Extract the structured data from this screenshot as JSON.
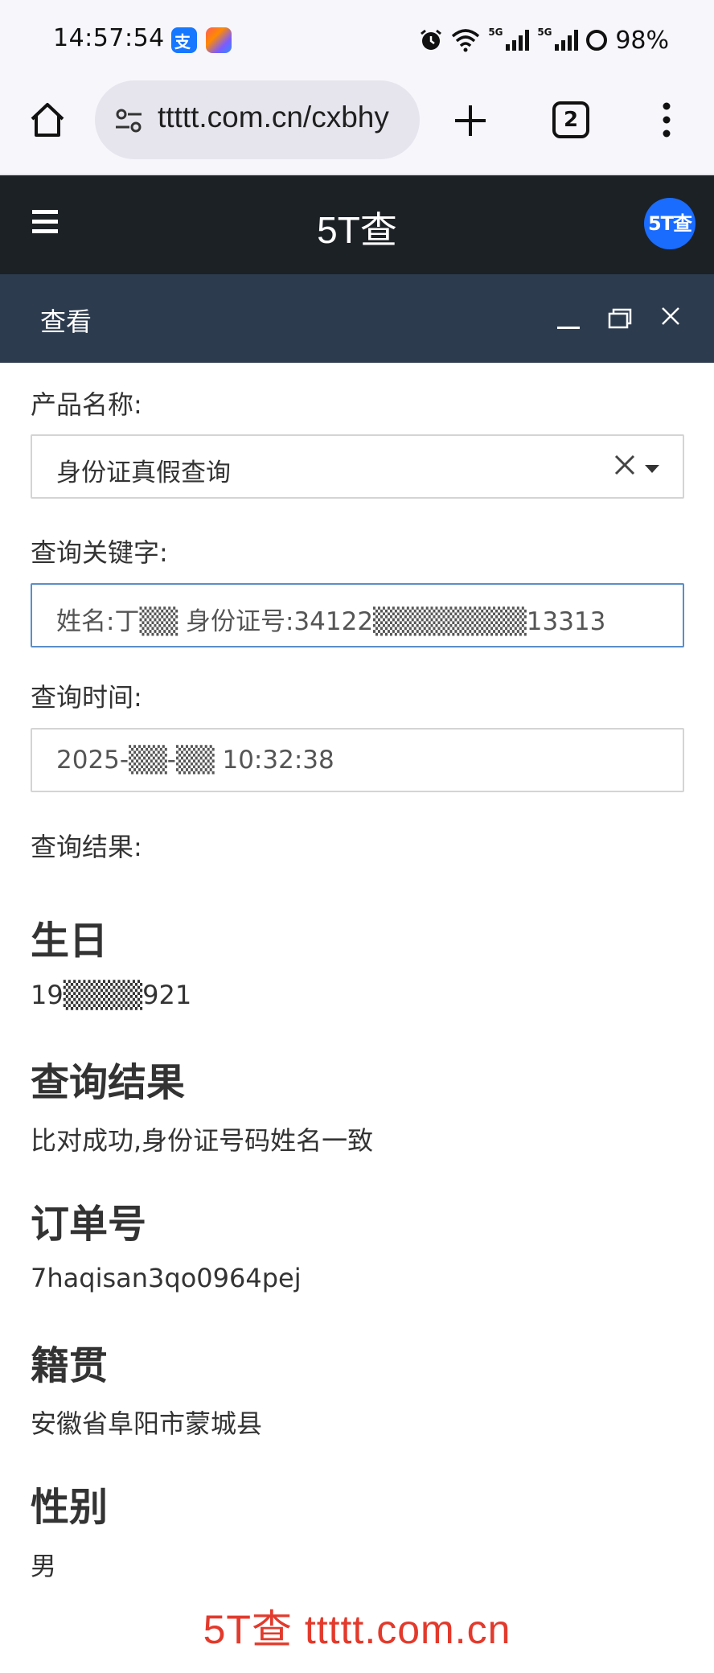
{
  "status_bar": {
    "time": "14:57:54",
    "battery": "98%",
    "icons": [
      "alipay-app-icon",
      "assistant-app-icon",
      "alarm-icon",
      "wifi-icon",
      "5g-signal-icon",
      "5g-signal-icon",
      "battery-ring-icon"
    ]
  },
  "browser": {
    "url": "ttttt.com.cn/cxbhy",
    "tab_count": "2",
    "icons": [
      "home-icon",
      "site-settings-icon",
      "plus-icon",
      "tabs-icon",
      "more-icon"
    ]
  },
  "site": {
    "title": "5T查",
    "avatar_text": "5T查",
    "menu_icon": "hamburger-icon"
  },
  "dialog": {
    "title": "查看",
    "controls": [
      "minimize-icon",
      "maximize-icon",
      "close-icon"
    ]
  },
  "form": {
    "product_label": "产品名称:",
    "product_value": "身份证真假查询",
    "keyword_label": "查询关键字:",
    "keyword_value": "姓名:丁▒▒ 身份证号:34122▒▒▒▒▒▒▒▒13313",
    "time_label": "查询时间:",
    "time_value": "2025-▒▒-▒▒ 10:32:38",
    "result_label": "查询结果:"
  },
  "results": [
    {
      "title": "生日",
      "value": "19▒▒▒▒921"
    },
    {
      "title": "查询结果",
      "value": "比对成功,身份证号码姓名一致"
    },
    {
      "title": "订单号",
      "value": "7haqisan3qo0964pej"
    },
    {
      "title": "籍贯",
      "value": "安徽省阜阳市蒙城县"
    },
    {
      "title": "性别",
      "value": "男"
    }
  ],
  "watermark": "5T查  ttttt.com.cn",
  "colors": {
    "site_header": "#1c2126",
    "dialog_header": "#2d3b4f",
    "focus_border": "#5a8ec8",
    "watermark": "#e23a2c",
    "avatar": "#1a6cff"
  }
}
